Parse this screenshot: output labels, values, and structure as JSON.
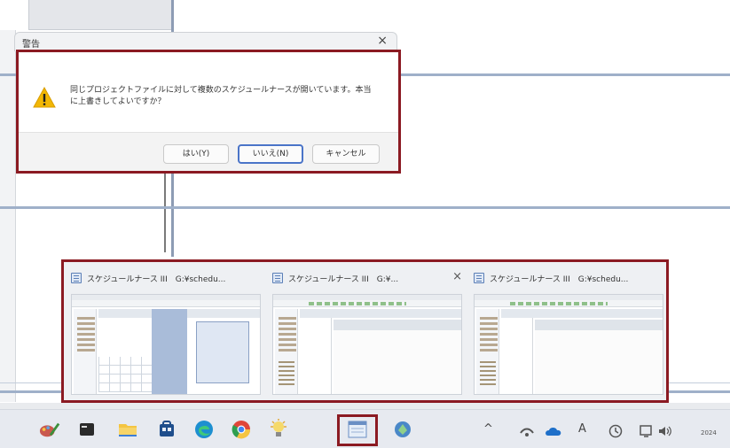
{
  "dialog": {
    "title": "警告",
    "close_glyph": "×",
    "message": "同じプロジェクトファイルに対して複数のスケジュールナースが開いています。本当に上書きしてよいですか？",
    "buttons": {
      "yes": "はい(Y)",
      "no": "いいえ(N)",
      "cancel": "キャンセル"
    }
  },
  "preview": {
    "windows": [
      {
        "title": "スケジュールナース III　G:¥schedu..."
      },
      {
        "title": "スケジュールナース III　G:¥...",
        "close_glyph": "×"
      },
      {
        "title": "スケジュールナース III　G:¥schedu..."
      }
    ]
  },
  "taskbar": {
    "icons": [
      "paint-app-icon",
      "terminal-icon",
      "file-explorer-icon",
      "store-icon",
      "edge-icon",
      "chrome-icon",
      "idea-icon",
      "schedule-nurse-icon",
      "app-icon"
    ],
    "tray": {
      "chevron": "^",
      "ime": "A",
      "date_fragment": "2024"
    }
  },
  "colors": {
    "highlight": "#8b1a22",
    "focus": "#4a74c8",
    "warning": "#f2b705"
  }
}
